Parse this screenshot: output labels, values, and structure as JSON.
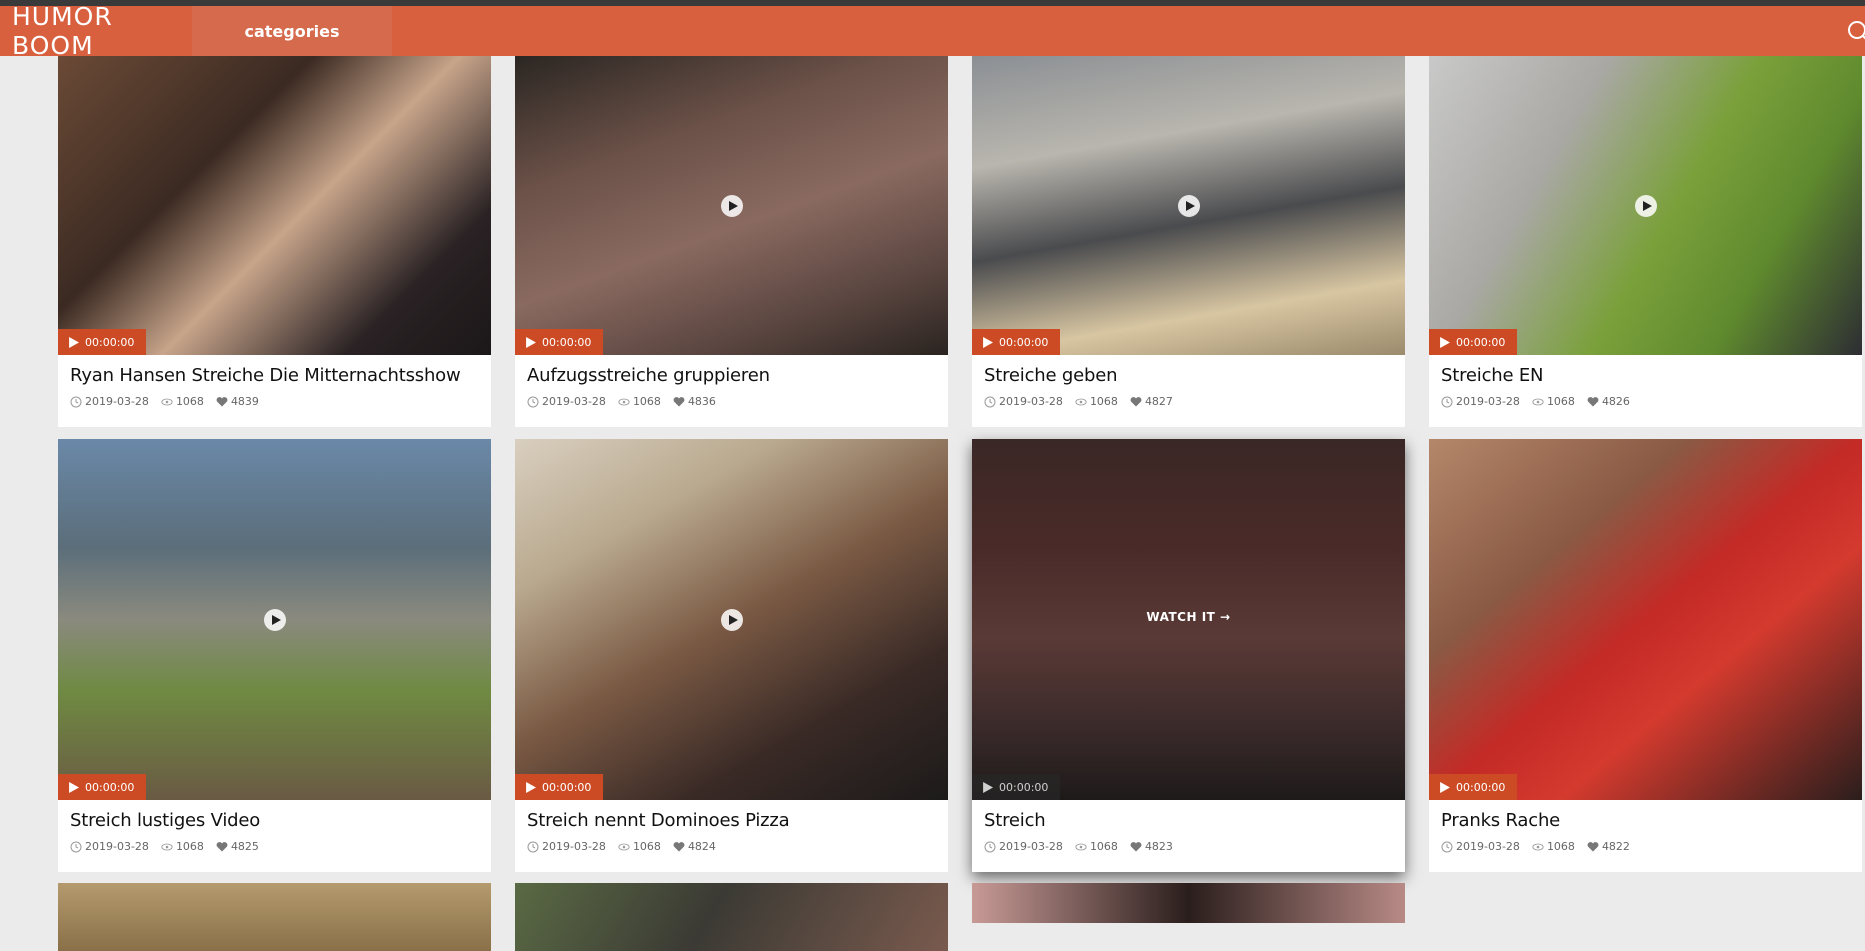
{
  "header": {
    "logo": "HUMOR BOOM",
    "nav_categories": "categories",
    "accent_color": "#d9603f",
    "search_icon": "search-icon"
  },
  "cards": [
    {
      "title": "Ryan Hansen Streiche Die Mitternachtsshow",
      "duration": "00:00:00",
      "date": "2019-03-28",
      "views": "1068",
      "likes": "4839"
    },
    {
      "title": "Aufzugsstreiche gruppieren",
      "duration": "00:00:00",
      "date": "2019-03-28",
      "views": "1068",
      "likes": "4836"
    },
    {
      "title": "Streiche geben",
      "duration": "00:00:00",
      "date": "2019-03-28",
      "views": "1068",
      "likes": "4827"
    },
    {
      "title": "Streiche EN",
      "duration": "00:00:00",
      "date": "2019-03-28",
      "views": "1068",
      "likes": "4826"
    },
    {
      "title": "Streich lustiges Video",
      "duration": "00:00:00",
      "date": "2019-03-28",
      "views": "1068",
      "likes": "4825"
    },
    {
      "title": "Streich nennt Dominoes Pizza",
      "duration": "00:00:00",
      "date": "2019-03-28",
      "views": "1068",
      "likes": "4824"
    },
    {
      "title": "Streich",
      "duration": "00:00:00",
      "date": "2019-03-28",
      "views": "1068",
      "likes": "4823",
      "watch_label": "WATCH IT"
    },
    {
      "title": "Pranks Rache",
      "duration": "00:00:00",
      "date": "2019-03-28",
      "views": "1068",
      "likes": "4822"
    }
  ]
}
